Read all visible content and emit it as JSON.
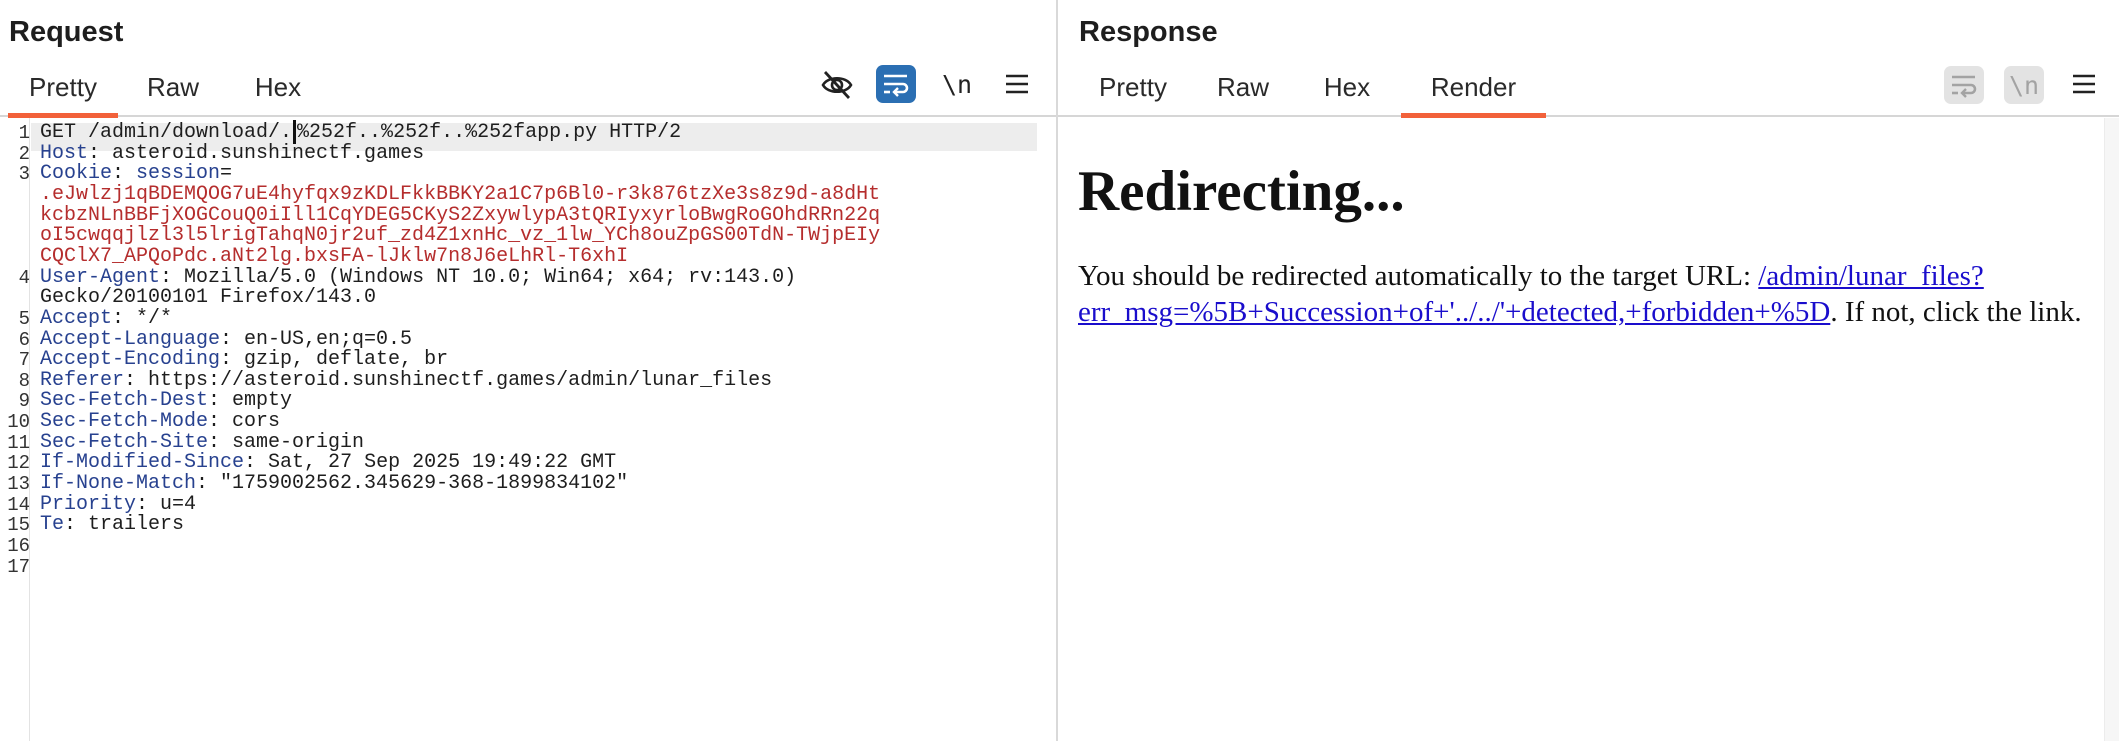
{
  "request": {
    "title": "Request",
    "tabs": [
      {
        "label": "Pretty",
        "active": true
      },
      {
        "label": "Raw",
        "active": false
      },
      {
        "label": "Hex",
        "active": false
      }
    ],
    "toolbar": {
      "hide_icon": "eye-off-icon",
      "wrap_icon": "word-wrap-icon",
      "newline_label": "\\n",
      "menu_icon": "hamburger-menu-icon"
    },
    "lines": [
      {
        "num": "1",
        "parts": [
          {
            "t": "GET /admin/download/.",
            "c": ""
          },
          {
            "caret": true
          },
          {
            "t": "%252f..%252f..%252fapp.py HTTP/2",
            "c": ""
          }
        ]
      },
      {
        "num": "2",
        "parts": [
          {
            "t": "Host",
            "c": "hname"
          },
          {
            "t": ": asteroid.sunshinectf.games",
            "c": ""
          }
        ]
      },
      {
        "num": "3",
        "parts": [
          {
            "t": "Cookie",
            "c": "hname"
          },
          {
            "t": ": ",
            "c": ""
          },
          {
            "t": "session",
            "c": "hname"
          },
          {
            "t": "=",
            "c": ""
          }
        ]
      },
      {
        "num": "",
        "parts": [
          {
            "t": ".eJwlzj1qBDEMQOG7uE4hyfqx9zKDLFkkBBKY2a1C7p6Bl0-r3k876tzXe3s8z9d-a8dHt",
            "c": "cval"
          }
        ]
      },
      {
        "num": "",
        "parts": [
          {
            "t": "kcbzNLnBBFjXOGCouQ0iIll1CqYDEG5CKyS2ZxywlypA3tQRIyxyrloBwgRoGOhdRRn22q",
            "c": "cval"
          }
        ]
      },
      {
        "num": "",
        "parts": [
          {
            "t": "oI5cwqqjlzl3l5lrigTahqN0jr2uf_zd4Z1xnHc_vz_1lw_YCh8ouZpGS00TdN-TWjpEIy",
            "c": "cval"
          }
        ]
      },
      {
        "num": "",
        "parts": [
          {
            "t": "CQClX7_APQoPdc.aNt2lg.bxsFA-lJklw7n8J6eLhRl-T6xhI",
            "c": "cval"
          }
        ]
      },
      {
        "num": "4",
        "parts": [
          {
            "t": "User-Agent",
            "c": "hname"
          },
          {
            "t": ": Mozilla/5.0 (Windows NT 10.0; Win64; x64; rv:143.0)",
            "c": ""
          }
        ]
      },
      {
        "num": "",
        "parts": [
          {
            "t": "Gecko/20100101 Firefox/143.0",
            "c": ""
          }
        ]
      },
      {
        "num": "5",
        "parts": [
          {
            "t": "Accept",
            "c": "hname"
          },
          {
            "t": ": */*",
            "c": ""
          }
        ]
      },
      {
        "num": "6",
        "parts": [
          {
            "t": "Accept-Language",
            "c": "hname"
          },
          {
            "t": ": en-US,en;q=0.5",
            "c": ""
          }
        ]
      },
      {
        "num": "7",
        "parts": [
          {
            "t": "Accept-Encoding",
            "c": "hname"
          },
          {
            "t": ": gzip, deflate, br",
            "c": ""
          }
        ]
      },
      {
        "num": "8",
        "parts": [
          {
            "t": "Referer",
            "c": "hname"
          },
          {
            "t": ": https://asteroid.sunshinectf.games/admin/lunar_files",
            "c": ""
          }
        ]
      },
      {
        "num": "9",
        "parts": [
          {
            "t": "Sec-Fetch-Dest",
            "c": "hname"
          },
          {
            "t": ": empty",
            "c": ""
          }
        ]
      },
      {
        "num": "10",
        "parts": [
          {
            "t": "Sec-Fetch-Mode",
            "c": "hname"
          },
          {
            "t": ": cors",
            "c": ""
          }
        ]
      },
      {
        "num": "11",
        "parts": [
          {
            "t": "Sec-Fetch-Site",
            "c": "hname"
          },
          {
            "t": ": same-origin",
            "c": ""
          }
        ]
      },
      {
        "num": "12",
        "parts": [
          {
            "t": "If-Modified-Since",
            "c": "hname"
          },
          {
            "t": ": Sat, 27 Sep 2025 19:49:22 GMT",
            "c": ""
          }
        ]
      },
      {
        "num": "13",
        "parts": [
          {
            "t": "If-None-Match",
            "c": "hname"
          },
          {
            "t": ": \"1759002562.345629-368-1899834102\"",
            "c": ""
          }
        ]
      },
      {
        "num": "14",
        "parts": [
          {
            "t": "Priority",
            "c": "hname"
          },
          {
            "t": ": u=4",
            "c": ""
          }
        ]
      },
      {
        "num": "15",
        "parts": [
          {
            "t": "Te",
            "c": "hname"
          },
          {
            "t": ": trailers",
            "c": ""
          }
        ]
      },
      {
        "num": "16",
        "parts": []
      },
      {
        "num": "17",
        "parts": []
      }
    ]
  },
  "response": {
    "title": "Response",
    "tabs": [
      {
        "label": "Pretty",
        "active": false
      },
      {
        "label": "Raw",
        "active": false
      },
      {
        "label": "Hex",
        "active": false
      },
      {
        "label": "Render",
        "active": true
      }
    ],
    "toolbar": {
      "wrap_icon": "word-wrap-icon",
      "newline_label": "\\n",
      "menu_icon": "hamburger-menu-icon"
    },
    "render": {
      "heading": "Redirecting...",
      "text_before": "You should be redirected automatically to the target URL: ",
      "link": "/admin/lunar_files?err_msg=%5B+Succession+of+'../../'+detected,+forbidden+%5D",
      "text_after": ". If not, click the link."
    }
  },
  "colors": {
    "accent_tab": "#f2613a",
    "header_name": "#27418f",
    "cookie_value": "#b52d2d",
    "link": "#1a0dcc",
    "wrap_button_active": "#2b6fb3"
  }
}
